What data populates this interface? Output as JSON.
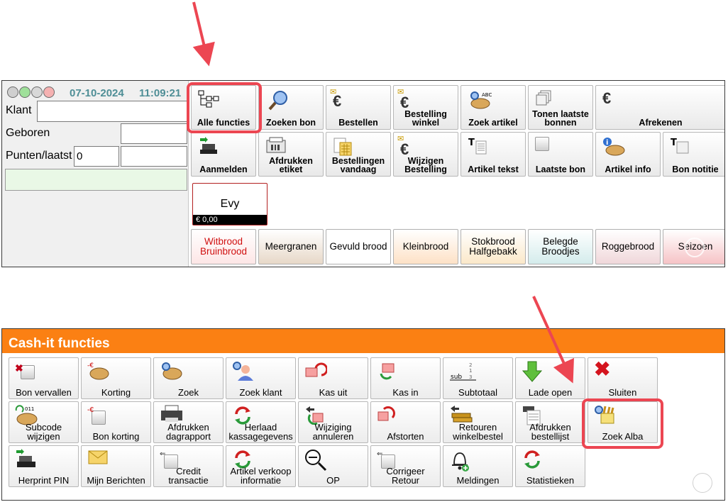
{
  "top": {
    "date": "07-10-2024",
    "time": "11:09:21",
    "labels": {
      "customer": "Klant",
      "born": "Geboren",
      "points": "Punten/laatst"
    },
    "fields": {
      "customer": "",
      "born": "",
      "points": "0",
      "last": ""
    },
    "buttons_row1": [
      {
        "label": "Alle functies",
        "icon": "hierarchy-icon"
      },
      {
        "label": "Zoeken bon",
        "icon": "magnifier-icon"
      },
      {
        "label": "Bestellen",
        "icon": "euro-icon"
      },
      {
        "label": "Bestelling winkel",
        "icon": "euro-envelope-icon"
      },
      {
        "label": "Zoek artikel",
        "icon": "bread-search-icon"
      },
      {
        "label": "Tonen laatste bonnen",
        "icon": "receipts-stack-icon"
      },
      {
        "label": "Afrekenen",
        "icon": "euro-icon"
      }
    ],
    "buttons_row2": [
      {
        "label": "Aanmelden",
        "icon": "register-icon"
      },
      {
        "label": "Afdrukken etiket",
        "icon": "label-printer-icon"
      },
      {
        "label": "Bestellingen vandaag",
        "icon": "calendar-icon"
      },
      {
        "label": "Wijzigen Bestelling",
        "icon": "euro-envelope-icon"
      },
      {
        "label": "Artikel tekst",
        "icon": "text-list-icon"
      },
      {
        "label": "Laatste bon",
        "icon": "receipt-icon"
      },
      {
        "label": "Artikel info",
        "icon": "bread-info-icon"
      },
      {
        "label": "Bon notitie",
        "icon": "note-icon"
      }
    ],
    "employee": {
      "name": "Evy",
      "amount": "€ 0,00"
    },
    "categories": [
      {
        "label": "Witbrood Bruinbrood",
        "bg": "#fde6e6",
        "color": "#d01010"
      },
      {
        "label": "Meergranen",
        "bg": "#e7d8c8",
        "color": "#000000"
      },
      {
        "label": "Gevuld brood",
        "bg": "#ffffff",
        "color": "#000000"
      },
      {
        "label": "Kleinbrood",
        "bg": "#fde1c6",
        "color": "#000000"
      },
      {
        "label": "Stokbrood Halfgebakk",
        "bg": "#fbe8c9",
        "color": "#000000"
      },
      {
        "label": "Belegde Broodjes",
        "bg": "#d4ecec",
        "color": "#000000"
      },
      {
        "label": "Roggebrood",
        "bg": "#f0d7da",
        "color": "#000000"
      },
      {
        "label": "Seizoen",
        "bg": "#f6c3c6",
        "color": "#000000"
      }
    ]
  },
  "functions": {
    "title": "Cash-it functies",
    "rows": [
      [
        {
          "label": "Bon vervallen",
          "icon": "cancel-receipt-icon"
        },
        {
          "label": "Korting",
          "icon": "bread-discount-icon"
        },
        {
          "label": "Zoek",
          "icon": "bread-search-icon"
        },
        {
          "label": "Zoek klant",
          "icon": "customer-search-icon"
        },
        {
          "label": "Kas uit",
          "icon": "cash-out-icon"
        },
        {
          "label": "Kas in",
          "icon": "cash-in-icon"
        },
        {
          "label": "Subtotaal",
          "icon": "subtotal-icon"
        },
        {
          "label": "Lade open",
          "icon": "down-arrow-icon"
        },
        {
          "label": "Sluiten",
          "icon": "close-icon"
        }
      ],
      [
        {
          "label": "Subcode wijzigen",
          "icon": "subcode-icon"
        },
        {
          "label": "Bon korting",
          "icon": "receipt-discount-icon"
        },
        {
          "label": "Afdrukken dagrapport",
          "icon": "printer-icon"
        },
        {
          "label": "Herlaad kassagegevens",
          "icon": "refresh-icon"
        },
        {
          "label": "Wijziging annuleren",
          "icon": "undo-icon"
        },
        {
          "label": "Afstorten",
          "icon": "deposit-icon"
        },
        {
          "label": "Retouren winkelbestel",
          "icon": "return-icon"
        },
        {
          "label": "Afdrukken bestellijst",
          "icon": "order-list-icon"
        },
        {
          "label": "Zoek Alba",
          "icon": "alba-search-icon"
        }
      ],
      [
        {
          "label": "Herprint PIN",
          "icon": "pin-terminal-icon"
        },
        {
          "label": "Mijn Berichten",
          "icon": "envelope-icon"
        },
        {
          "label": "Credit transactie",
          "icon": "credit-icon"
        },
        {
          "label": "Artikel verkoop informatie",
          "icon": "refresh-icon"
        },
        {
          "label": "OP",
          "icon": "zoom-out-icon"
        },
        {
          "label": "Corrigeer Retour",
          "icon": "correct-return-icon"
        },
        {
          "label": "Meldingen",
          "icon": "bell-icon"
        },
        {
          "label": "Statistieken",
          "icon": "refresh-icon"
        }
      ]
    ]
  }
}
